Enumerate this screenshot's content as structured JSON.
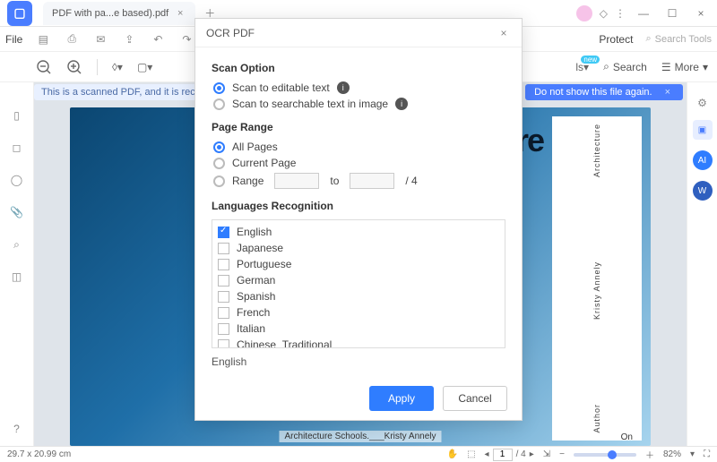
{
  "titlebar": {
    "tab_label": "PDF with pa...e based).pdf"
  },
  "menubar": {
    "file": "File",
    "protect": "Protect",
    "search_tools": "Search Tools"
  },
  "toolbar": {
    "search": "Search",
    "more": "More"
  },
  "notice": {
    "left_text": "This is a scanned PDF, and it is recommen",
    "right_text": "Do not show this file again.",
    "close": "×"
  },
  "document": {
    "big_text": "re",
    "side": {
      "top": "Architecture",
      "mid": "Kristy Annely",
      "bottom": "Author"
    },
    "footer_text": "Architecture Schools.___Kristy Annely",
    "footer_on": "On"
  },
  "status": {
    "dimensions": "29.7 x 20.99 cm",
    "page_current": "1",
    "page_total": "/ 4",
    "zoom": "82%"
  },
  "dialog": {
    "title": "OCR PDF",
    "scan_option": {
      "heading": "Scan Option",
      "editable": "Scan to editable text",
      "searchable": "Scan to searchable text in image"
    },
    "page_range": {
      "heading": "Page Range",
      "all": "All Pages",
      "current": "Current Page",
      "range": "Range",
      "to": "to",
      "total": "/ 4"
    },
    "languages": {
      "heading": "Languages Recognition",
      "items": [
        "English",
        "Japanese",
        "Portuguese",
        "German",
        "Spanish",
        "French",
        "Italian",
        "Chinese_Traditional"
      ],
      "selected_summary": "English"
    },
    "buttons": {
      "apply": "Apply",
      "cancel": "Cancel"
    }
  }
}
